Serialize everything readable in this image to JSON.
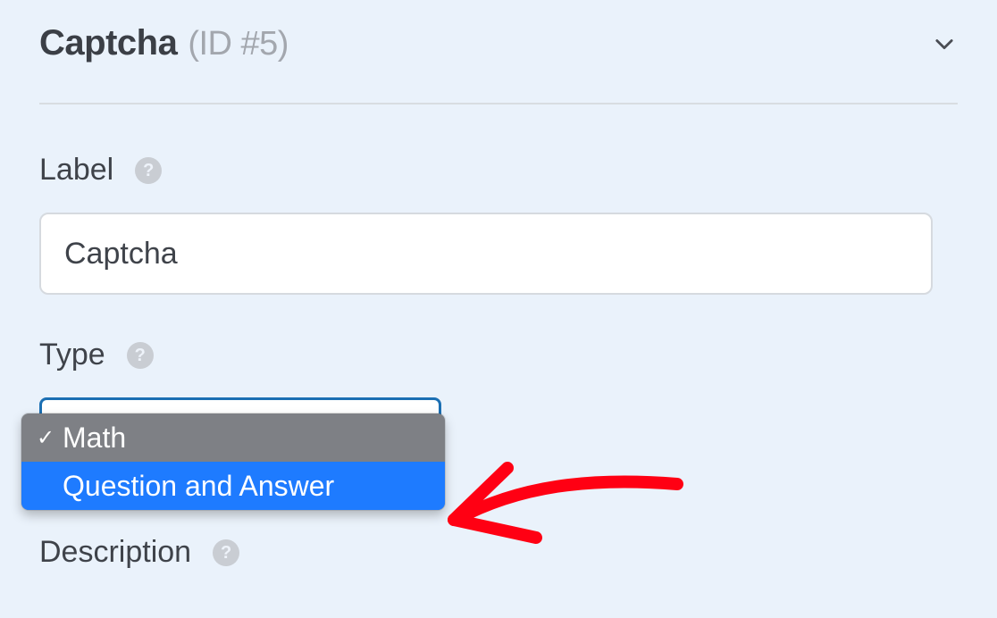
{
  "header": {
    "title": "Captcha",
    "id_text": "(ID #5)"
  },
  "fields": {
    "label": {
      "title": "Label",
      "value": "Captcha"
    },
    "type": {
      "title": "Type",
      "options": [
        {
          "label": "Math",
          "selected": true,
          "highlighted": false
        },
        {
          "label": "Question and Answer",
          "selected": false,
          "highlighted": true
        }
      ]
    },
    "description": {
      "title": "Description"
    }
  },
  "icons": {
    "help_glyph": "?",
    "check_glyph": "✓"
  }
}
